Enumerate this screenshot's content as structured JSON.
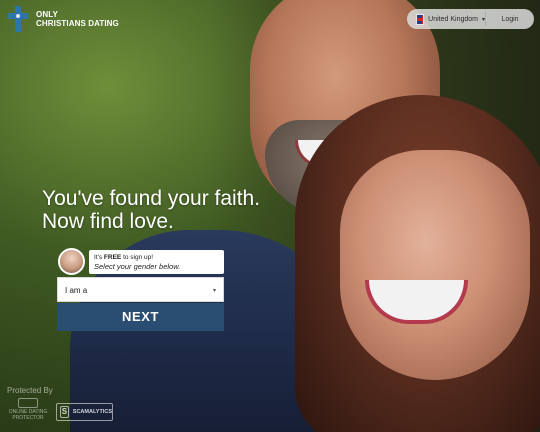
{
  "header": {
    "logo_line1": "ONLY",
    "logo_line2": "CHRISTIANS DATING",
    "country_label": "United Kingdom",
    "login_label": "Login"
  },
  "hero": {
    "headline_line1": "You've found your faith.",
    "headline_line2": "Now find love."
  },
  "signup": {
    "bubble_prefix": "It's ",
    "bubble_free": "FREE",
    "bubble_suffix": " to sign up!",
    "bubble_instruction": "Select your gender below.",
    "select_value": "I am a",
    "next_label": "NEXT"
  },
  "footer": {
    "protected_by": "Protected By",
    "badge1_line1": "ONLINE DATING",
    "badge1_line2": "PROTECTOR",
    "badge2_line1": "SCAMALYTICS"
  },
  "colors": {
    "brand_blue": "#2b78a8",
    "next_button": "#2a4d72"
  },
  "icons": {
    "logo": "cross-icon",
    "flag": "uk-flag-icon",
    "dropdown": "chevron-down-icon",
    "badge": "shield-icon"
  }
}
